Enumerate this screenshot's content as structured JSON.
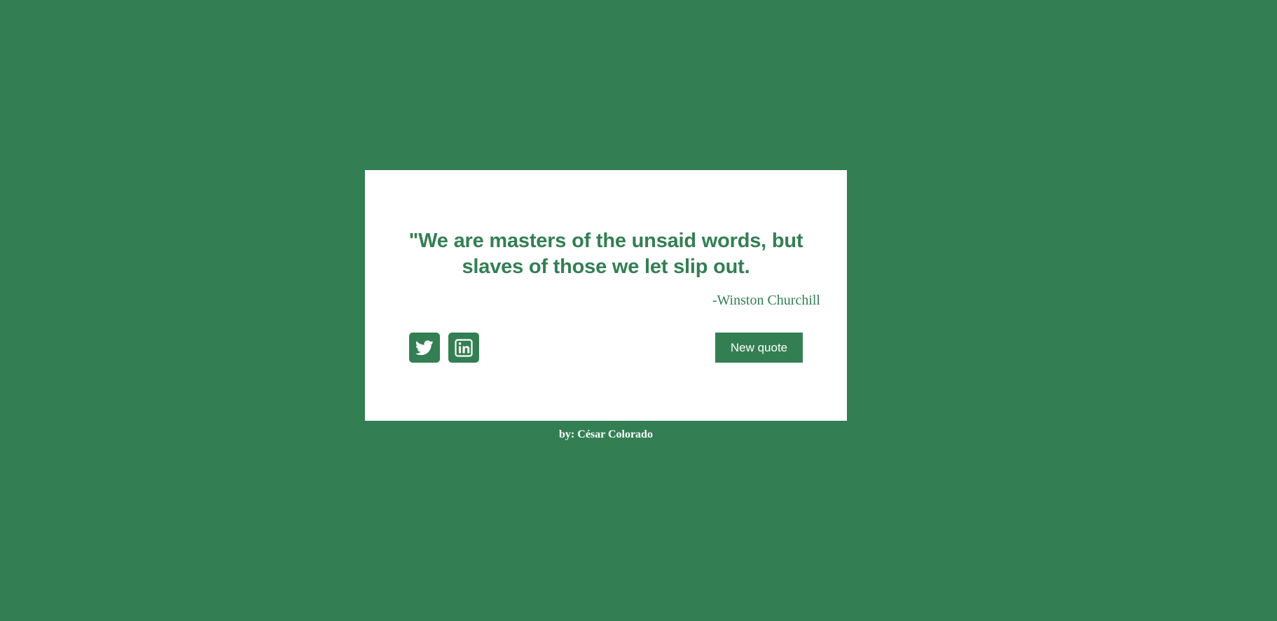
{
  "quote": {
    "text": "\"We are masters of the unsaid words, but slaves of those we let slip out.",
    "author": "-Winston Churchill"
  },
  "actions": {
    "twitter_icon": "twitter-icon",
    "linkedin_icon": "linkedin-icon",
    "new_quote_label": "New quote"
  },
  "footer": {
    "credit": "by: César Colorado"
  },
  "colors": {
    "background": "#337f53",
    "card": "#ffffff",
    "accent": "#337f53"
  }
}
